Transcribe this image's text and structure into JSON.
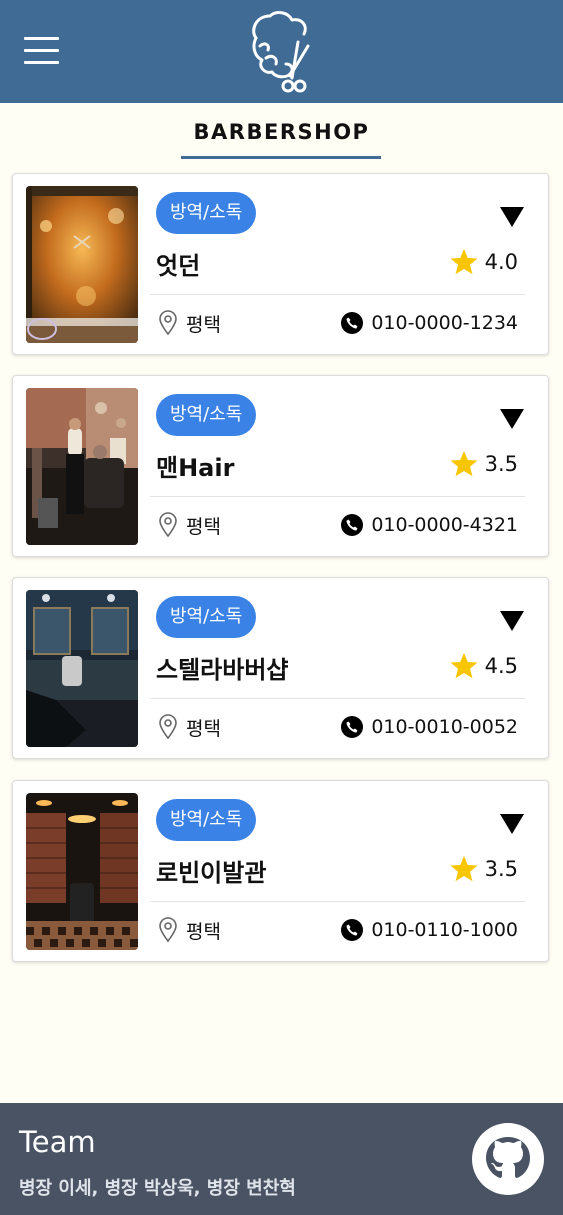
{
  "header": {
    "menu_icon": "hamburger-menu-icon",
    "logo_icon": "barber-scissors-logo-icon",
    "background_color": "#3f6b94"
  },
  "page": {
    "title": "BARBERSHOP"
  },
  "shops": [
    {
      "badge": "방역/소독",
      "name": "엇던",
      "rating": "4.0",
      "location": "평택",
      "phone": "010-0000-1234",
      "expand_icon": "triangle-down-icon"
    },
    {
      "badge": "방역/소독",
      "name": "맨Hair",
      "rating": "3.5",
      "location": "평택",
      "phone": "010-0000-4321",
      "expand_icon": "triangle-down-icon"
    },
    {
      "badge": "방역/소독",
      "name": "스텔라바버샵",
      "rating": "4.5",
      "location": "평택",
      "phone": "010-0010-0052",
      "expand_icon": "triangle-down-icon"
    },
    {
      "badge": "방역/소독",
      "name": "로빈이발관",
      "rating": "3.5",
      "location": "평택",
      "phone": "010-0110-1000",
      "expand_icon": "triangle-down-icon"
    }
  ],
  "footer": {
    "title": "Team",
    "members": "병장 이세, 병장 박상욱, 병장 변찬혁",
    "github_icon": "github-icon"
  },
  "colors": {
    "badge": "#3b82e6",
    "star": "#f7c600",
    "footer": "#4a5363",
    "page_background": "#fffef4"
  }
}
